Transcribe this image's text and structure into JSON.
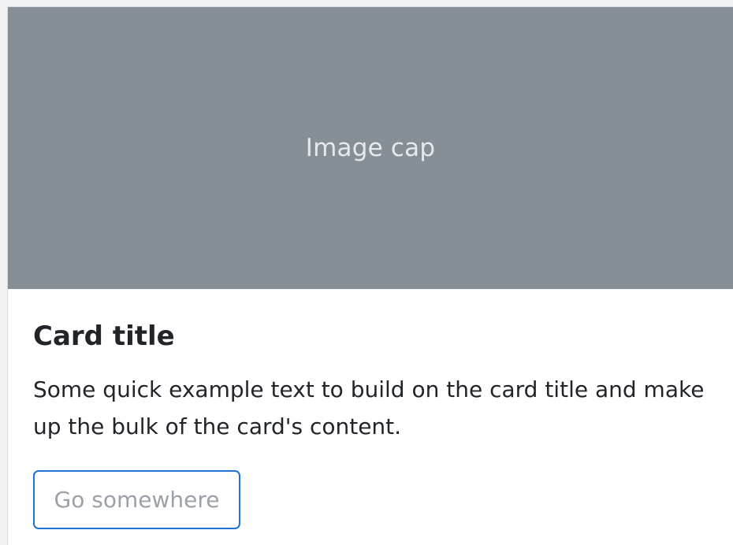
{
  "card": {
    "image_cap": "Image cap",
    "title": "Card title",
    "text": "Some quick example text to build on the card title and make up the bulk of the card's content.",
    "button_label": "Go somewhere"
  }
}
